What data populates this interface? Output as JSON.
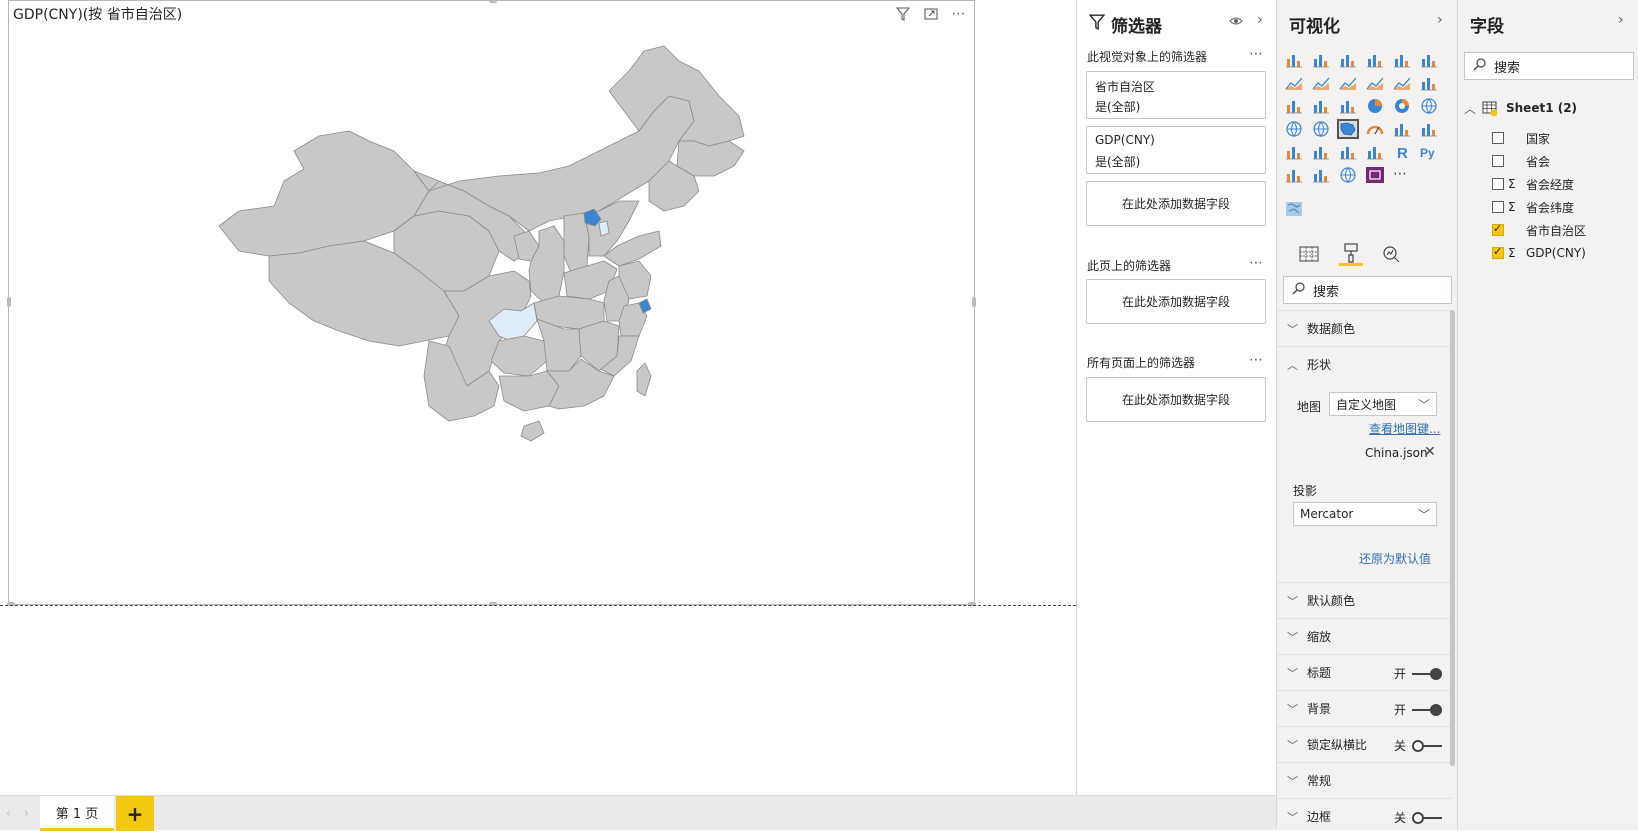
{
  "visual": {
    "title": "GDP(CNY)(按 省市自治区)"
  },
  "tabs": {
    "page1": "第 1 页",
    "add": "+"
  },
  "filters": {
    "title": "筛选器",
    "visual_section": "此视觉对象上的筛选器",
    "cards": [
      {
        "field": "省市自治区",
        "value": "是(全部)"
      },
      {
        "field": "GDP(CNY)",
        "value": "是(全部)"
      }
    ],
    "add_field": "在此处添加数据字段",
    "page_section": "此页上的筛选器",
    "all_pages_section": "所有页面上的筛选器"
  },
  "visualizations": {
    "title": "可视化",
    "search_placeholder": "搜索",
    "sections": {
      "data_colors": "数据颜色",
      "shape": "形状",
      "default_colors": "默认颜色",
      "zoom": "缩放",
      "title": "标题",
      "background": "背景",
      "lock_aspect": "锁定纵横比",
      "general": "常规",
      "border": "边框"
    },
    "shape": {
      "map_label": "地图",
      "map_value": "自定义地图",
      "view_map_keys": "查看地图键...",
      "file": "China.json",
      "projection_label": "投影",
      "projection_value": "Mercator",
      "reset": "还原为默认值"
    },
    "toggles": {
      "on": "开",
      "off": "关"
    }
  },
  "fields": {
    "title": "字段",
    "search_placeholder": "搜索",
    "table": "Sheet1 (2)",
    "items": [
      {
        "label": "国家",
        "checked": false,
        "sigma": false
      },
      {
        "label": "省会",
        "checked": false,
        "sigma": false
      },
      {
        "label": "省会经度",
        "checked": false,
        "sigma": true
      },
      {
        "label": "省会纬度",
        "checked": false,
        "sigma": true
      },
      {
        "label": "省市自治区",
        "checked": true,
        "sigma": false
      },
      {
        "label": "GDP(CNY)",
        "checked": true,
        "sigma": true
      }
    ],
    "sigma_symbol": "Σ"
  },
  "colors": {
    "accent": "#f2c811",
    "map_fill": "#c8c8c8",
    "map_highlight_dark": "#3a86d6",
    "map_highlight_light": "#dcecf8"
  }
}
